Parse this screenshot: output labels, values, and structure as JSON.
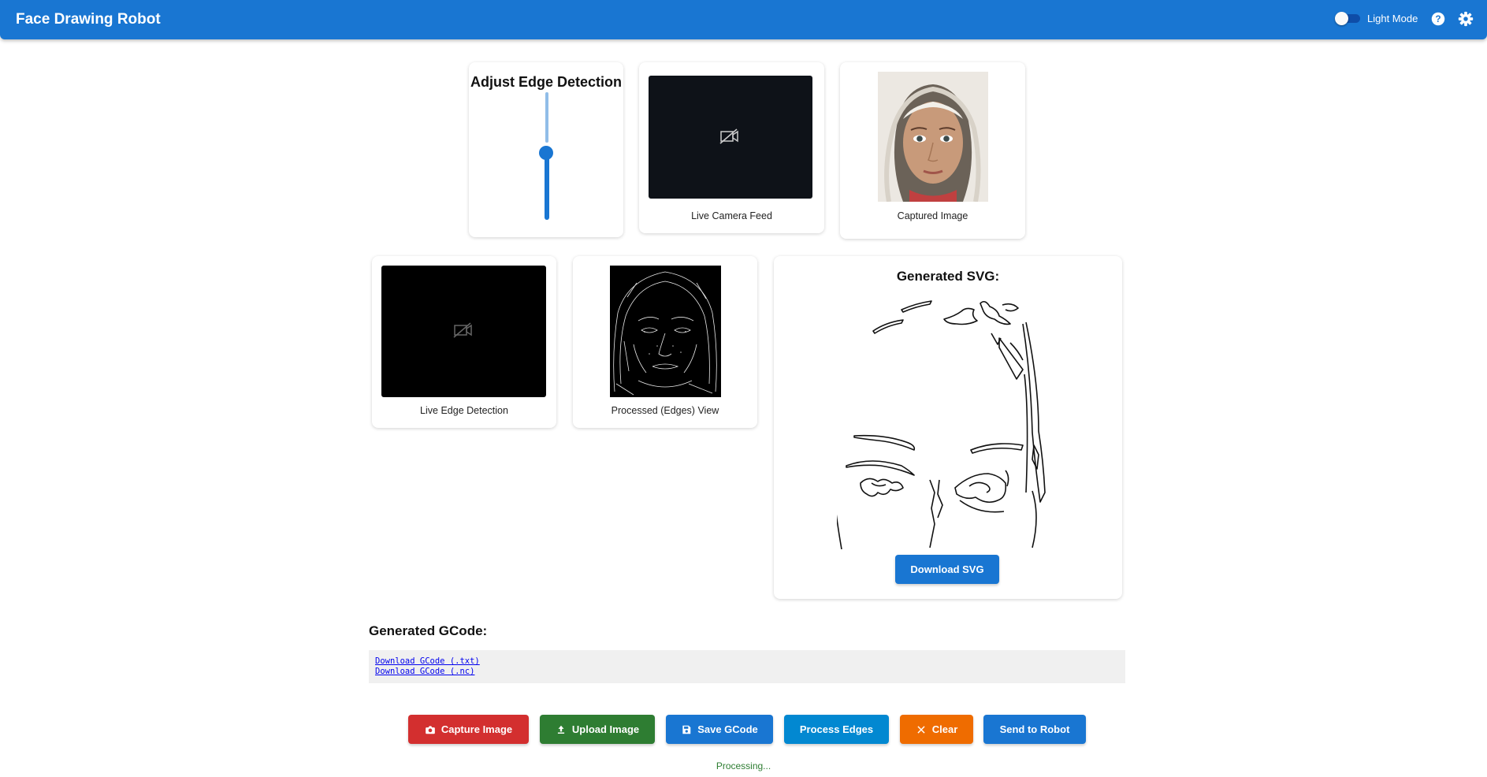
{
  "header": {
    "title": "Face Drawing Robot",
    "mode_label": "Light Mode",
    "icons": [
      "help-icon",
      "settings-icon"
    ]
  },
  "edge_control": {
    "title": "Adjust Edge Detection",
    "slider_value_fraction": 0.54
  },
  "camera_feed": {
    "caption": "Live Camera Feed",
    "icon": "camera-off-icon"
  },
  "captured": {
    "caption": "Captured Image"
  },
  "live_edges": {
    "caption": "Live Edge Detection",
    "icon": "camera-off-icon"
  },
  "processed": {
    "caption": "Processed (Edges) View"
  },
  "svg_panel": {
    "title": "Generated SVG:",
    "download_label": "Download SVG"
  },
  "gcode": {
    "title": "Generated GCode:",
    "links": [
      "Download GCode (.txt)",
      "Download GCode (.nc)"
    ]
  },
  "actions": [
    {
      "label": "Capture Image",
      "icon": "camera-icon",
      "color": "#d32f2f"
    },
    {
      "label": "Upload Image",
      "icon": "upload-icon",
      "color": "#2e7d32"
    },
    {
      "label": "Save GCode",
      "icon": "save-icon",
      "color": "#1976d2"
    },
    {
      "label": "Process Edges",
      "icon": "",
      "color": "#0288d1"
    },
    {
      "label": "Clear",
      "icon": "close-icon",
      "color": "#ef6c00"
    },
    {
      "label": "Send to Robot",
      "icon": "",
      "color": "#1976d2"
    }
  ],
  "status": "Processing...",
  "colors": {
    "primary": "#1976d2",
    "status": "#2e7d32"
  }
}
